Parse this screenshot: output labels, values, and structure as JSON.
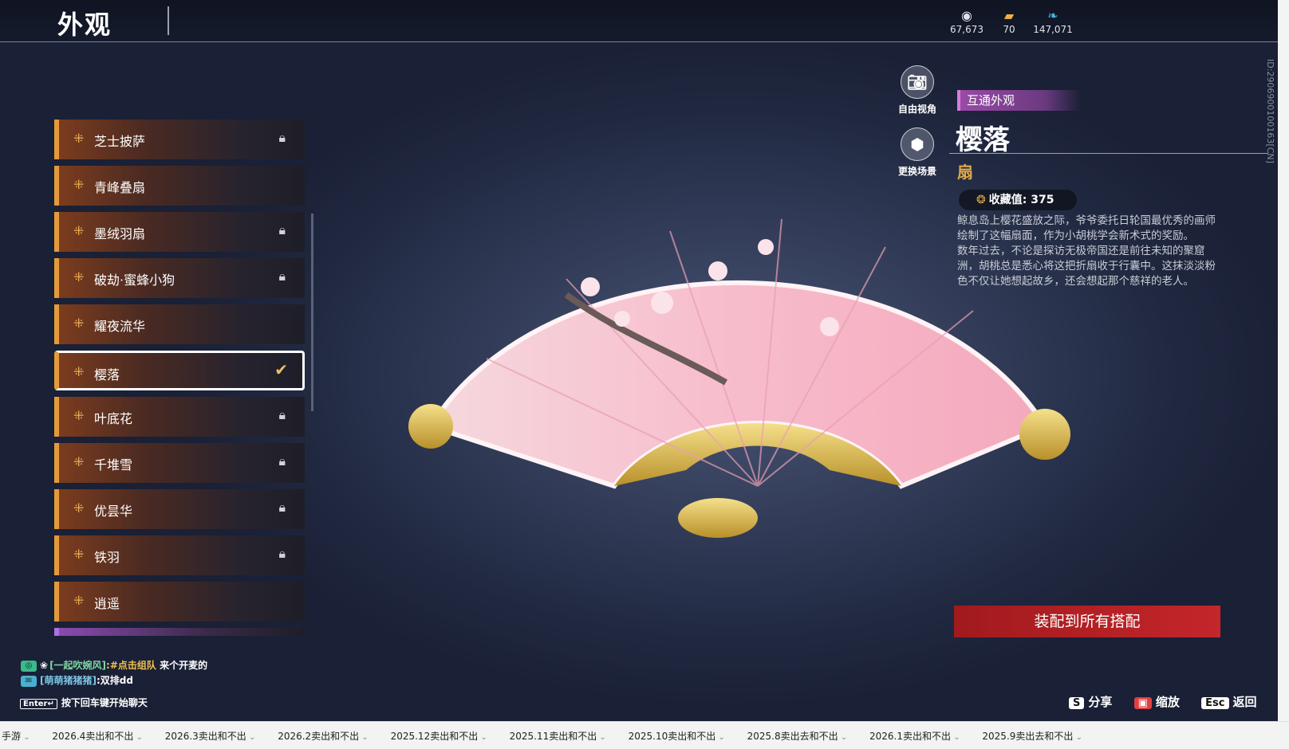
{
  "header": {
    "title": "外观",
    "currencies": [
      {
        "icon": "coin-stack-icon",
        "value": "67,673"
      },
      {
        "icon": "ticket-icon",
        "value": "70"
      },
      {
        "icon": "feather-icon",
        "value": "147,071"
      }
    ]
  },
  "list": {
    "items": [
      {
        "label": "芝士披萨",
        "locked": true
      },
      {
        "label": "青峰叠扇",
        "locked": false
      },
      {
        "label": "墨绒羽扇",
        "locked": true
      },
      {
        "label": "破劫·蜜蜂小狗",
        "locked": true
      },
      {
        "label": "耀夜流华",
        "locked": false
      },
      {
        "label": "樱落",
        "locked": false,
        "selected": true
      },
      {
        "label": "叶底花",
        "locked": true
      },
      {
        "label": "千堆雪",
        "locked": true
      },
      {
        "label": "优昙华",
        "locked": true
      },
      {
        "label": "铁羽",
        "locked": true
      },
      {
        "label": "逍遥",
        "locked": false
      }
    ]
  },
  "side_buttons": {
    "camera": "自由视角",
    "scene": "更换场景"
  },
  "detail": {
    "tag": "互通外观",
    "name": "樱落",
    "type": "扇",
    "collect_label": "收藏值: 375",
    "desc1": "鲸息岛上樱花盛放之际，爷爷委托日轮国最优秀的画师绘制了这幅扇面，作为小胡桃学会新术式的奖励。",
    "desc2": "数年过去，不论是探访无极帝国还是前往未知的聚窟洲，胡桃总是悉心将这把折扇收于行囊中。这抹淡淡粉色不仅让她想起故乡，还会想起那个慈祥的老人。",
    "equip_label": "装配到所有搭配",
    "id_text": "ID:2906900100163[CN]"
  },
  "chat": {
    "line1_name": "[一起吹婉风]",
    "line1_link": ":#点击组队",
    "line1_text": " 来个开麦的",
    "line2_name": "[萌萌猪猪猪]",
    "line2_text": ":双排dd",
    "enter_key": "Enter↵",
    "enter_hint": "按下回车键开始聊天"
  },
  "hints": [
    {
      "key": "S",
      "label": "分享"
    },
    {
      "key": "▣",
      "label": "缩放"
    },
    {
      "key": "Esc",
      "label": "返回"
    }
  ],
  "taskbar": {
    "items": [
      "手游",
      "2026.4卖出和不出",
      "2026.3卖出和不出",
      "2026.2卖出和不出",
      "2025.12卖出和不出",
      "2025.11卖出和不出",
      "2025.10卖出和不出",
      "2025.8卖出去和不出",
      "2026.1卖出和不出",
      "2025.9卖出去和不出"
    ]
  },
  "colors": {
    "accent_orange": "#e59a3a",
    "equip_red": "#c4262a",
    "tag_purple": "#9a4aa6",
    "gold": "#e0a94a"
  }
}
